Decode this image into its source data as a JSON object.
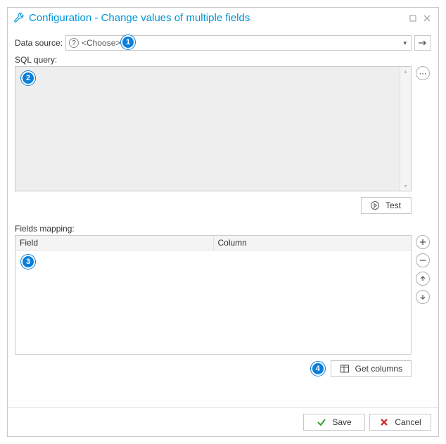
{
  "window": {
    "title": "Configuration - Change values of multiple fields"
  },
  "data_source": {
    "label": "Data source:",
    "placeholder": "<Choose>"
  },
  "sql": {
    "label": "SQL query:"
  },
  "buttons": {
    "test": "Test",
    "get_columns": "Get columns",
    "save": "Save",
    "cancel": "Cancel"
  },
  "fields": {
    "label": "Fields mapping:",
    "col_field": "Field",
    "col_column": "Column"
  },
  "markers": {
    "m1": "1",
    "m2": "2",
    "m3": "3",
    "m4": "4"
  }
}
